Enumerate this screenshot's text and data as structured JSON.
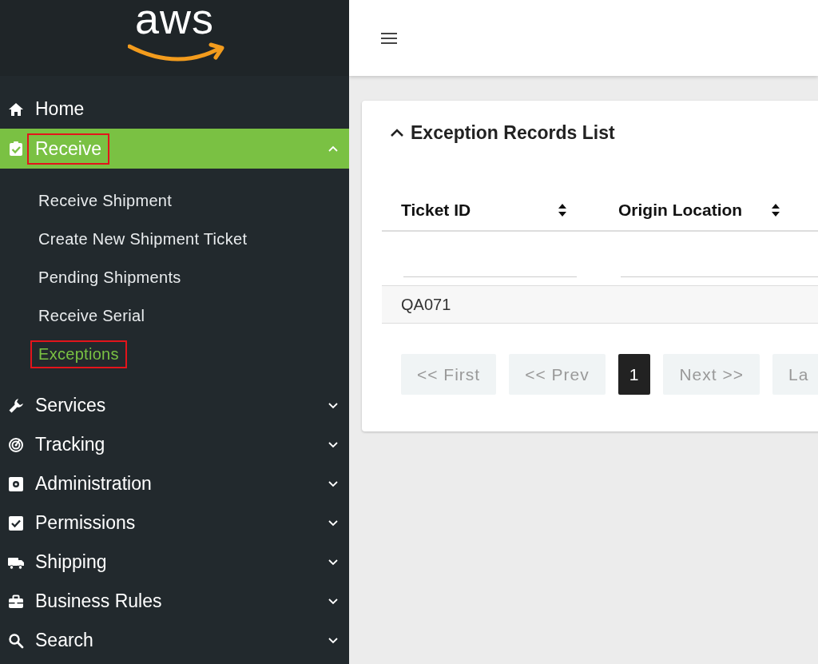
{
  "logo": {
    "text": "aws"
  },
  "sidebar": {
    "items": [
      {
        "kind": "link",
        "label": "Home",
        "selected": false,
        "highlighted": false
      },
      {
        "kind": "group",
        "label": "Receive",
        "selected": true,
        "highlighted": true,
        "expanded": true,
        "children": [
          {
            "label": "Receive Shipment",
            "selected": false,
            "highlighted": false
          },
          {
            "label": "Create New Shipment Ticket",
            "selected": false,
            "highlighted": false
          },
          {
            "label": "Pending Shipments",
            "selected": false,
            "highlighted": false
          },
          {
            "label": "Receive Serial",
            "selected": false,
            "highlighted": false
          },
          {
            "label": "Exceptions",
            "selected": true,
            "highlighted": true
          }
        ]
      },
      {
        "kind": "group",
        "label": "Services",
        "selected": false,
        "highlighted": false,
        "expanded": false
      },
      {
        "kind": "group",
        "label": "Tracking",
        "selected": false,
        "highlighted": false,
        "expanded": false
      },
      {
        "kind": "group",
        "label": "Administration",
        "selected": false,
        "highlighted": false,
        "expanded": false
      },
      {
        "kind": "group",
        "label": "Permissions",
        "selected": false,
        "highlighted": false,
        "expanded": false
      },
      {
        "kind": "group",
        "label": "Shipping",
        "selected": false,
        "highlighted": false,
        "expanded": false
      },
      {
        "kind": "group",
        "label": "Business Rules",
        "selected": false,
        "highlighted": false,
        "expanded": false
      },
      {
        "kind": "group",
        "label": "Search",
        "selected": false,
        "highlighted": false,
        "expanded": false
      }
    ]
  },
  "card": {
    "title": "Exception Records List",
    "expanded": true,
    "table": {
      "columns": [
        {
          "label": "Ticket ID"
        },
        {
          "label": "Origin Location"
        }
      ],
      "rows": [
        {
          "cells": [
            "QA071"
          ]
        }
      ]
    },
    "pagination": [
      {
        "label": "<< First",
        "selected": false
      },
      {
        "label": "<< Prev",
        "selected": false
      },
      {
        "label": "1",
        "selected": true
      },
      {
        "label": "Next >>",
        "selected": false
      },
      {
        "label": "La",
        "selected": false
      }
    ]
  }
}
